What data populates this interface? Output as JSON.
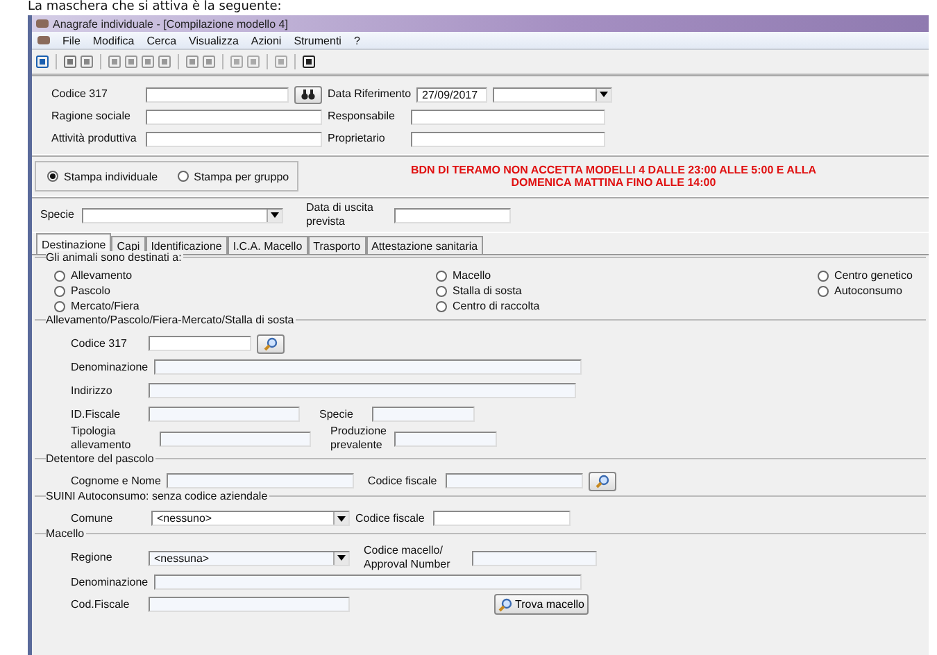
{
  "intro": "La maschera che si attiva è la seguente:",
  "window": {
    "title": "Anagrafe individuale - [Compilazione modello 4]"
  },
  "menu": [
    "File",
    "Modifica",
    "Cerca",
    "Visualizza",
    "Azioni",
    "Strumenti",
    "?"
  ],
  "header": {
    "codice_317": {
      "label": "Codice 317"
    },
    "data_riferimento": {
      "label": "Data Riferimento",
      "value": "27/09/2017"
    },
    "ragione_sociale": {
      "label": "Ragione sociale"
    },
    "responsabile": {
      "label": "Responsabile"
    },
    "attivita_produttiva": {
      "label": "Attività produttiva"
    },
    "proprietario": {
      "label": "Proprietario"
    }
  },
  "print_mode": [
    {
      "label": "Stampa individuale",
      "selected": true
    },
    {
      "label": "Stampa per gruppo",
      "selected": false
    }
  ],
  "notice": [
    "BDN DI TERAMO NON ACCETTA MODELLI 4 DALLE 23:00 ALLE 5:00 E ALLA",
    "DOMENICA MATTINA FINO ALLE 14:00"
  ],
  "specie": {
    "label": "Specie"
  },
  "data_uscita": {
    "label": "Data di uscita prevista"
  },
  "tabs": [
    {
      "label": "Destinazione",
      "selected": true
    },
    {
      "label": "Capi",
      "selected": false
    },
    {
      "label": "Identificazione",
      "selected": false
    },
    {
      "label": "I.C.A. Macello",
      "selected": false
    },
    {
      "label": "Trasporto",
      "selected": false
    },
    {
      "label": "Attestazione sanitaria",
      "selected": false
    }
  ],
  "destinazione": {
    "title": "Gli animali sono destinati a:",
    "columns": [
      [
        {
          "label": "Allevamento",
          "selected": false
        },
        {
          "label": "Pascolo",
          "selected": false
        },
        {
          "label": "Mercato/Fiera",
          "selected": false
        }
      ],
      [
        {
          "label": "Macello",
          "selected": false
        },
        {
          "label": "Stalla di sosta",
          "selected": false
        },
        {
          "label": "Centro di raccolta",
          "selected": false
        }
      ],
      [
        {
          "label": "Centro genetico",
          "selected": false
        },
        {
          "label": "Autoconsumo",
          "selected": false
        }
      ]
    ]
  },
  "allevamento": {
    "title": "Allevamento/Pascolo/Fiera-Mercato/Stalla di sosta",
    "codice_317": "Codice 317",
    "denominazione": "Denominazione",
    "indirizzo": "Indirizzo",
    "id_fiscale": "ID.Fiscale",
    "specie": "Specie",
    "tipologia": "Tipologia allevamento",
    "produzione": "Produzione prevalente"
  },
  "detentore": {
    "title": "Detentore del pascolo",
    "cognome_nome": "Cognome e Nome",
    "codice_fiscale": "Codice fiscale"
  },
  "suini": {
    "title": "SUINI Autoconsumo: senza codice aziendale",
    "comune": "Comune",
    "comune_value": "<nessuno>",
    "codice_fiscale": "Codice fiscale"
  },
  "macello": {
    "title": "Macello",
    "regione": "Regione",
    "regione_value": "<nessuna>",
    "codice_macello": "Codice macello/ Approval Number",
    "denominazione": "Denominazione",
    "cod_fiscale": "Cod.Fiscale",
    "trova": "Trova macello"
  }
}
